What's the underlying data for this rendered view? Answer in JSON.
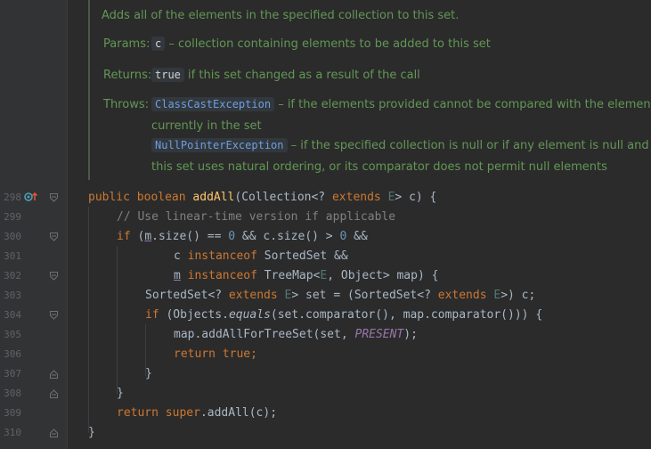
{
  "doc": {
    "summary": "Adds all of the elements in the specified collection to this set.",
    "params_label": "Params:",
    "params_code": "c",
    "params_text": "– collection containing elements to be added to this set",
    "returns_label": "Returns:",
    "returns_code": "true",
    "returns_text": "if this set changed as a result of the call",
    "throws_label": "Throws:",
    "throws1_code": "ClassCastException",
    "throws1_text": "– if the elements provided cannot be compared with the elements",
    "throws1_cont": "currently in the set",
    "throws2_code": "NullPointerException",
    "throws2_text": "– if the specified collection is null or if any element is null and",
    "throws2_cont": "this set uses natural ordering, or its comparator does not permit null elements"
  },
  "line_numbers": [
    "298",
    "299",
    "300",
    "301",
    "302",
    "303",
    "304",
    "305",
    "306",
    "307",
    "308",
    "309",
    "310"
  ],
  "code": {
    "l298": {
      "public": "public",
      "boolean": "boolean",
      "name": "addAll",
      "a": "(Collection<? ",
      "extends": "extends",
      "E": "E",
      "b": "> c) {"
    },
    "l299": {
      "comment": "// Use linear-time version if applicable"
    },
    "l300": {
      "if": "if",
      "a": " (",
      "m": "m",
      ".size": ".size() == ",
      "zero1": "0",
      " and": " && c.size() > ",
      "zero2": "0",
      "end": " &&"
    },
    "l301": {
      "a": "c ",
      "instanceof": "instanceof",
      "b": " SortedSet &&"
    },
    "l302": {
      "m": "m",
      "sp": " ",
      "instanceof": "instanceof",
      "a": " TreeMap<",
      "E": "E",
      "b": ", Object> map) {"
    },
    "l303": {
      "a": "SortedSet<? ",
      "extends": "extends",
      "E": "E",
      "b": "> set = (SortedSet<? ",
      "extends2": "extends",
      "E2": "E",
      "c": ">) c;"
    },
    "l304": {
      "if": "if",
      "a": " (Objects.",
      "equals": "equals",
      "b": "(set.comparator(), map.comparator())) {"
    },
    "l305": {
      "a": "map.addAllForTreeSet(set, ",
      "present": "PRESENT",
      "b": ");"
    },
    "l306": {
      "return": "return",
      "true": "true",
      "semi": ";"
    },
    "l307": {
      "a": "}"
    },
    "l308": {
      "a": "}"
    },
    "l309": {
      "return": "return",
      "super": "super",
      "a": ".addAll(c);"
    },
    "l310": {
      "a": "}"
    }
  }
}
